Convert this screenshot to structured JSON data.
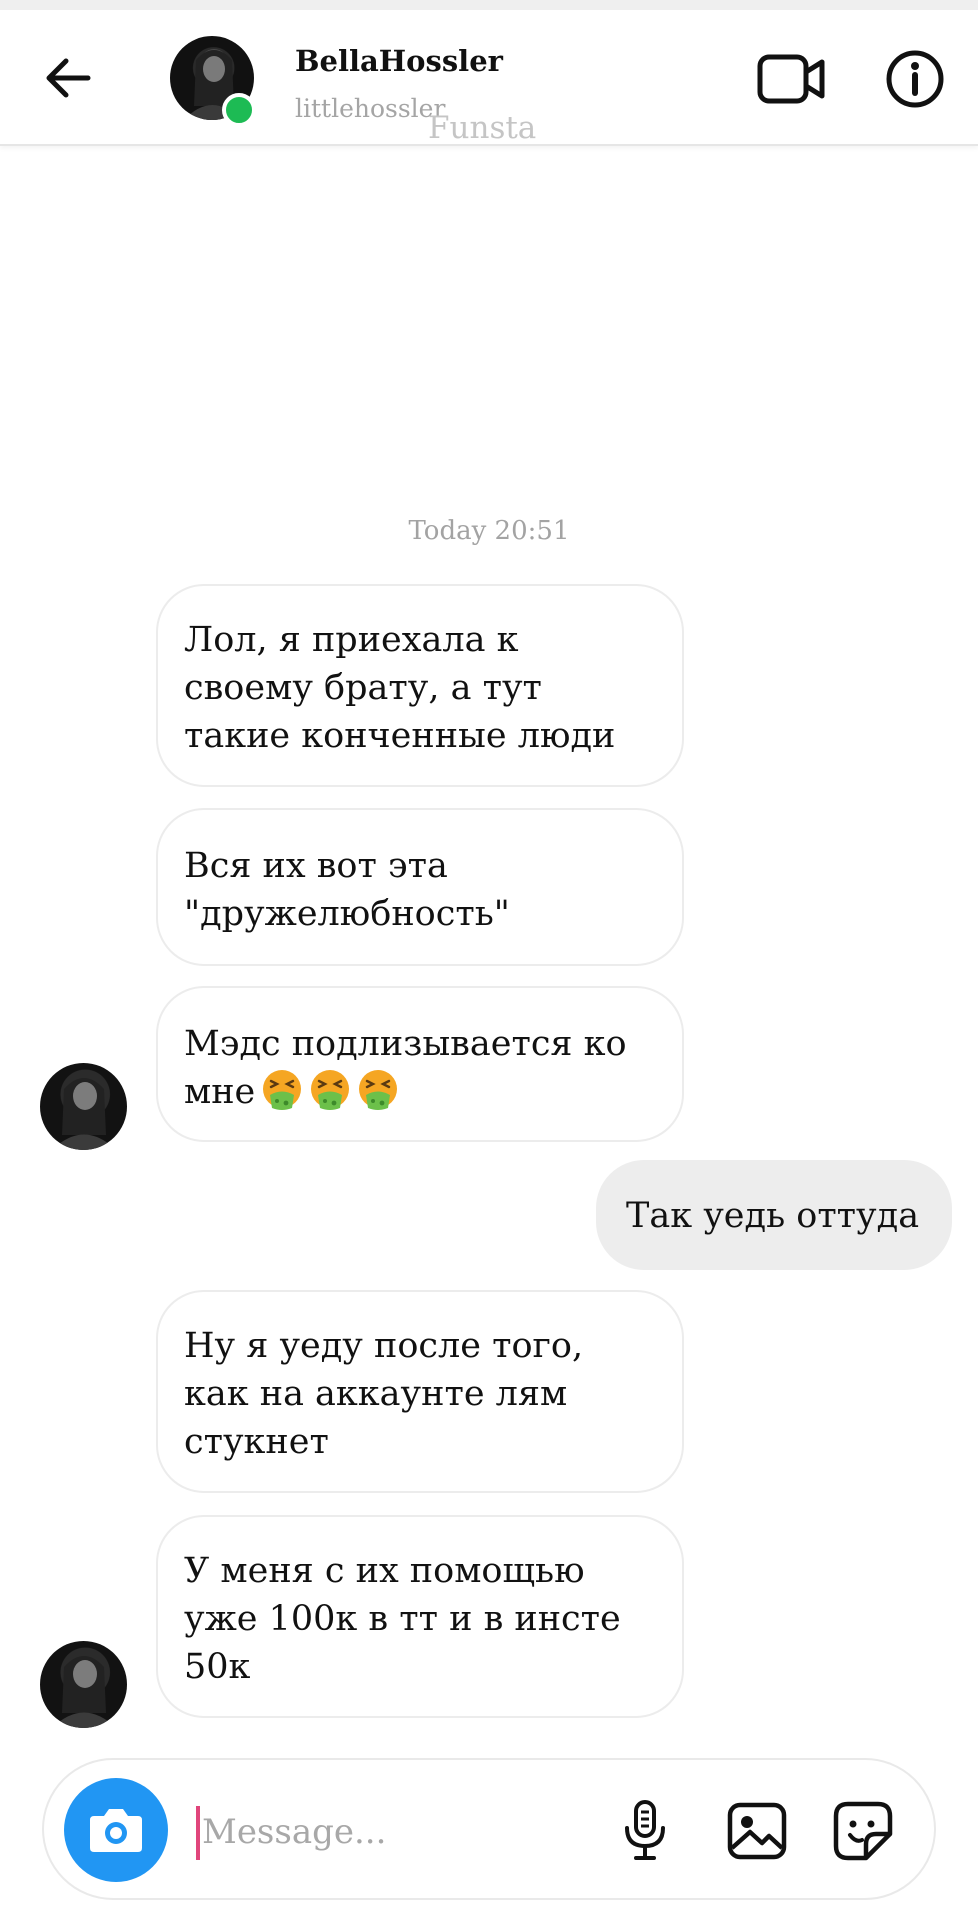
{
  "header": {
    "name": "BellaHossler",
    "username": "littlehossler",
    "watermark": "Funsta",
    "icons": {
      "back": "back-arrow-icon",
      "video": "video-call-icon",
      "info": "info-icon"
    },
    "online_color": "#1dbb54"
  },
  "chat": {
    "timestamp": "Today 20:51",
    "messages": [
      {
        "sender": "them",
        "lines": [
          "Лол, я приехала к",
          "своему брату, а тут",
          "такие конченные люди"
        ]
      },
      {
        "sender": "them",
        "lines": [
          "Вся их вот эта",
          "\"дружелюбность\""
        ]
      },
      {
        "sender": "them",
        "lines": [
          "Мэдс подлизывается ко",
          "мне"
        ],
        "emoji": [
          "face-vomiting",
          "face-vomiting",
          "face-vomiting"
        ]
      },
      {
        "sender": "me",
        "lines": [
          "Так уедь оттуда"
        ]
      },
      {
        "sender": "them",
        "lines": [
          "Ну я уеду после того,",
          "как на аккаунте лям",
          "стукнет"
        ]
      },
      {
        "sender": "them",
        "lines": [
          "У меня с их помощью",
          "уже 100к в тт и в инсте",
          "50к"
        ]
      }
    ]
  },
  "composer": {
    "placeholder": "Message...",
    "icons": {
      "camera": "camera-icon",
      "mic": "microphone-icon",
      "gallery": "gallery-icon",
      "sticker": "sticker-icon"
    },
    "accent_color": "#2196f3"
  }
}
